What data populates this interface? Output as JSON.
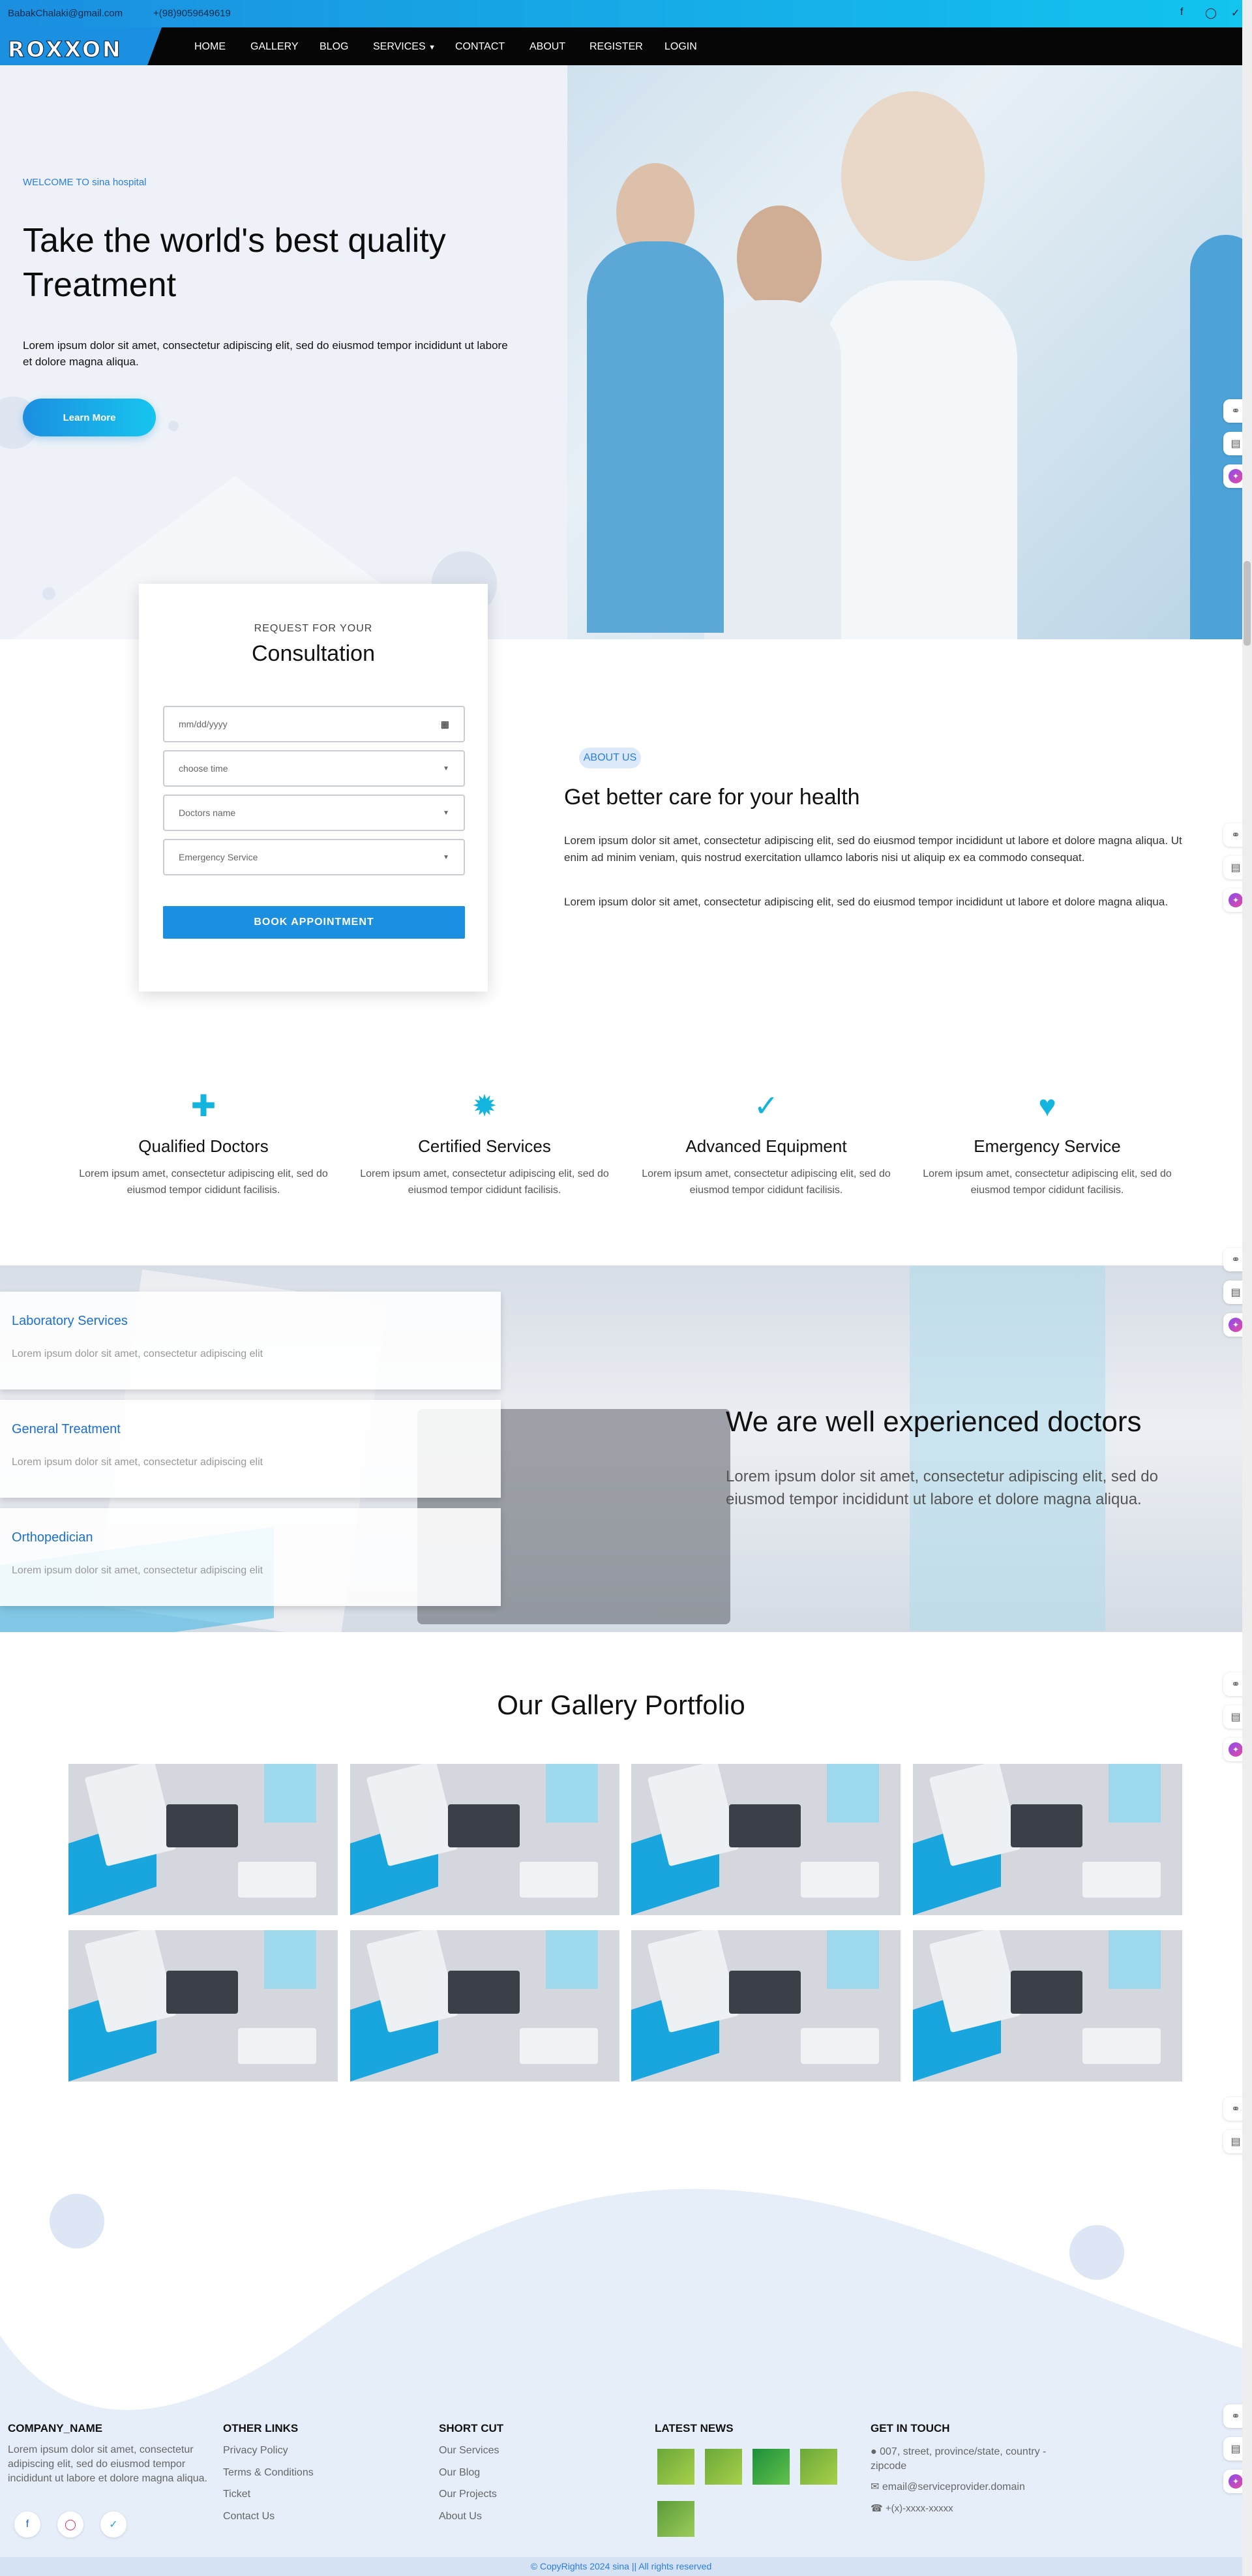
{
  "topbar": {
    "email": "BabakChalaki@gmail.com",
    "phone": "+(98)9059649619",
    "social_icons": [
      "facebook-icon",
      "instagram-icon",
      "twitter-icon"
    ]
  },
  "nav": {
    "logo": "ROXXON",
    "items": [
      "HOME",
      "GALLERY",
      "BLOG",
      "SERVICES",
      "CONTACT",
      "ABOUT",
      "REGISTER",
      "LOGIN"
    ]
  },
  "hero": {
    "welcome": "WELCOME TO sina hospital",
    "title": "Take the world's best quality Treatment",
    "text": "Lorem ipsum dolor sit amet, consectetur adipiscing elit, sed do eiusmod tempor incididunt ut labore et dolore magna aliqua.",
    "button": "Learn More"
  },
  "consultation": {
    "subtitle": "REQUEST FOR YOUR",
    "title": "Consultation",
    "date_placeholder": "mm/dd/yyyy",
    "time_placeholder": "choose time",
    "doctor_placeholder": "Doctors name",
    "service_placeholder": "Emergency Service",
    "button": "BOOK APPOINTMENT"
  },
  "about": {
    "badge": "ABOUT US",
    "title": "Get better care for your health",
    "paragraph1": "Lorem ipsum dolor sit amet, consectetur adipiscing elit, sed do eiusmod tempor incididunt ut labore et dolore magna aliqua. Ut enim ad minim veniam, quis nostrud exercitation ullamco laboris nisi ut aliquip ex ea commodo consequat.",
    "paragraph2": "Lorem ipsum dolor sit amet, consectetur adipiscing elit, sed do eiusmod tempor incididunt ut labore et dolore magna aliqua."
  },
  "features": [
    {
      "icon": "medical-kit-icon",
      "title": "Qualified Doctors",
      "text": "Lorem ipsum amet, consectetur adipiscing elit, sed do eiusmod tempor cididunt facilisis."
    },
    {
      "icon": "certified-badge-icon",
      "title": "Certified Services",
      "text": "Lorem ipsum amet, consectetur adipiscing elit, sed do eiusmod tempor cididunt facilisis."
    },
    {
      "icon": "stethoscope-icon",
      "title": "Advanced Equipment",
      "text": "Lorem ipsum amet, consectetur adipiscing elit, sed do eiusmod tempor cididunt facilisis."
    },
    {
      "icon": "heartbeat-icon",
      "title": "Emergency Service",
      "text": "Lorem ipsum amet, consectetur adipiscing elit, sed do eiusmod tempor cididunt facilisis."
    }
  ],
  "doctors": {
    "services": [
      {
        "title": "Laboratory Services",
        "text": "Lorem ipsum dolor sit amet, consectetur adipiscing elit"
      },
      {
        "title": "General Treatment",
        "text": "Lorem ipsum dolor sit amet, consectetur adipiscing elit"
      },
      {
        "title": "Orthopedician",
        "text": "Lorem ipsum dolor sit amet, consectetur adipiscing elit"
      }
    ],
    "title": "We are well experienced doctors",
    "text": "Lorem ipsum dolor sit amet, consectetur adipiscing elit, sed do eiusmod tempor incididunt ut labore et dolore magna aliqua."
  },
  "gallery": {
    "title": "Our Gallery Portfolio",
    "count": 8
  },
  "footer": {
    "company": {
      "heading": "COMPANY_NAME",
      "text": "Lorem ipsum dolor sit amet, consectetur adipiscing elit, sed do eiusmod tempor incididunt ut labore et dolore magna aliqua."
    },
    "other_links": {
      "heading": "OTHER LINKS",
      "items": [
        "Privacy Policy",
        "Terms & Conditions",
        "Ticket",
        "Contact Us"
      ]
    },
    "short_cut": {
      "heading": "SHORT CUT",
      "items": [
        "Our Services",
        "Our Blog",
        "Our Projects",
        "About Us"
      ]
    },
    "latest_news": {
      "heading": "LATEST NEWS"
    },
    "get_in_touch": {
      "heading": "GET IN TOUCH",
      "address": "007, street, province/state, country - zipcode",
      "email": "email@serviceprovider.domain",
      "phone": "+(x)-xxxx-xxxxx"
    },
    "copyright": "© CopyRights 2024 sina || All rights reserved"
  },
  "colors": {
    "accent": "#1b8fe0",
    "accent_light": "#17c5ef",
    "dark": "#060606"
  }
}
